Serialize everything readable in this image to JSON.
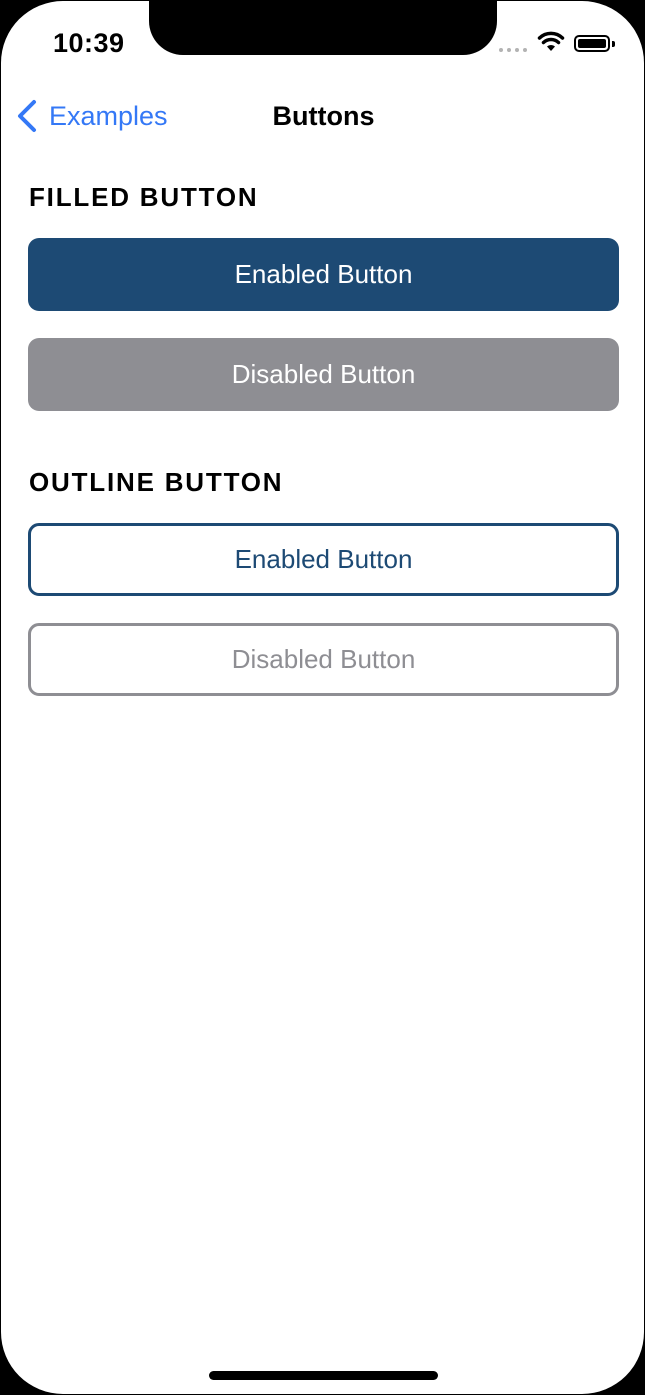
{
  "status_bar": {
    "time": "10:39",
    "icons": [
      "signal-icon",
      "wifi-icon",
      "battery-icon"
    ]
  },
  "nav": {
    "back_icon": "chevron-left-icon",
    "back_label": "Examples",
    "title": "Buttons"
  },
  "sections": {
    "filled": {
      "header": "FILLED BUTTON",
      "enabled_label": "Enabled Button",
      "disabled_label": "Disabled Button"
    },
    "outline": {
      "header": "OUTLINE BUTTON",
      "enabled_label": "Enabled Button",
      "disabled_label": "Disabled Button"
    }
  },
  "colors": {
    "accent_link": "#3478f6",
    "primary": "#1d4a74",
    "disabled": "#8e8e93"
  }
}
